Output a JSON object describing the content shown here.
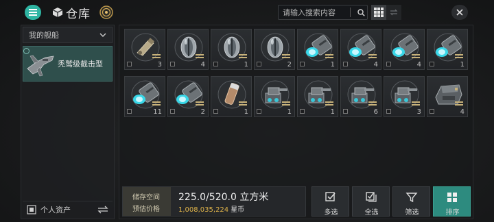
{
  "header": {
    "title": "仓库",
    "search_placeholder": "请输入搜索内容",
    "menu_icon": "hamburger-icon",
    "title_icon": "cube-icon",
    "close_icon": "close-icon"
  },
  "sidebar": {
    "dropdown_label": "我的舰船",
    "selected_ship": "秃鹫级截击型",
    "assets_label": "个人资产"
  },
  "items": [
    {
      "icon": "cannon-icon",
      "count": "3"
    },
    {
      "icon": "shield-capsule-icon",
      "count": "4"
    },
    {
      "icon": "shield-capsule-icon",
      "count": "1"
    },
    {
      "icon": "shield-capsule-icon",
      "count": "2"
    },
    {
      "icon": "plasma-canister-icon",
      "count": "1"
    },
    {
      "icon": "plasma-canister-icon",
      "count": "4"
    },
    {
      "icon": "plasma-canister-icon",
      "count": "4"
    },
    {
      "icon": "plasma-canister-icon",
      "count": "1"
    },
    {
      "icon": "plasma-canister-icon",
      "count": "11"
    },
    {
      "icon": "plasma-canister-icon",
      "count": "2"
    },
    {
      "icon": "shell-icon",
      "count": "1"
    },
    {
      "icon": "turret-icon",
      "count": "1"
    },
    {
      "icon": "turret-icon",
      "count": "1"
    },
    {
      "icon": "turret-icon",
      "count": "6"
    },
    {
      "icon": "turret-icon",
      "count": "3"
    },
    {
      "icon": "armor-module-icon",
      "count": "4"
    }
  ],
  "storage": {
    "space_label": "储存空间",
    "space_value": "225.0/520.0 立方米",
    "price_label": "预估价格",
    "price_value": "1,008,035,224",
    "price_unit": "星币"
  },
  "actions": [
    {
      "label": "多选",
      "icon": "check-square-icon",
      "active": false
    },
    {
      "label": "全选",
      "icon": "double-check-icon",
      "active": false
    },
    {
      "label": "筛选",
      "icon": "filter-icon",
      "active": false
    },
    {
      "label": "排序",
      "icon": "sort-grid-icon",
      "active": true
    }
  ],
  "colors": {
    "accent": "#2fb5a3",
    "active_button": "#2d8b7f",
    "price": "#e0b44a",
    "plasma": "#39d7e8"
  }
}
